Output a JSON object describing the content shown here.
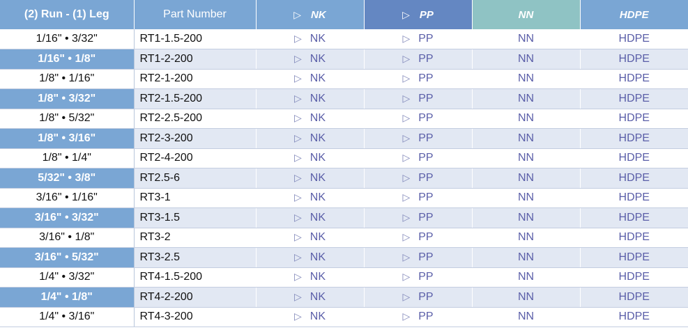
{
  "header": {
    "run_leg": "(2) Run - (1) Leg",
    "part_number": "Part Number",
    "materials": [
      {
        "label": "NK",
        "marker": "▷"
      },
      {
        "label": "PP",
        "marker": "▷"
      },
      {
        "label": "NN",
        "marker": ""
      },
      {
        "label": "HDPE",
        "marker": ""
      }
    ]
  },
  "colors": {
    "header_blue": "#7aa6d4",
    "header_pp": "#6487c2",
    "header_nn": "#8fc3c4",
    "row_alt": "#e2e8f3",
    "material_text": "#5a5ea8"
  },
  "rows": [
    {
      "size": "1/16\" • 3/32\"",
      "part": "RT1-1.5-200",
      "nk": "NK",
      "pp": "PP",
      "nn": "NN",
      "hdpe": "HDPE"
    },
    {
      "size": "1/16\" • 1/8\"",
      "part": "RT1-2-200",
      "nk": "NK",
      "pp": "PP",
      "nn": "NN",
      "hdpe": "HDPE"
    },
    {
      "size": "1/8\" • 1/16\"",
      "part": "RT2-1-200",
      "nk": "NK",
      "pp": "PP",
      "nn": "NN",
      "hdpe": "HDPE"
    },
    {
      "size": "1/8\" • 3/32\"",
      "part": "RT2-1.5-200",
      "nk": "NK",
      "pp": "PP",
      "nn": "NN",
      "hdpe": "HDPE"
    },
    {
      "size": "1/8\" • 5/32\"",
      "part": "RT2-2.5-200",
      "nk": "NK",
      "pp": "PP",
      "nn": "NN",
      "hdpe": "HDPE"
    },
    {
      "size": "1/8\" • 3/16\"",
      "part": "RT2-3-200",
      "nk": "NK",
      "pp": "PP",
      "nn": "NN",
      "hdpe": "HDPE"
    },
    {
      "size": "1/8\" • 1/4\"",
      "part": "RT2-4-200",
      "nk": "NK",
      "pp": "PP",
      "nn": "NN",
      "hdpe": "HDPE"
    },
    {
      "size": "5/32\" • 3/8\"",
      "part": "RT2.5-6",
      "nk": "NK",
      "pp": "PP",
      "nn": "NN",
      "hdpe": "HDPE"
    },
    {
      "size": "3/16\" • 1/16\"",
      "part": "RT3-1",
      "nk": "NK",
      "pp": "PP",
      "nn": "NN",
      "hdpe": "HDPE"
    },
    {
      "size": "3/16\" • 3/32\"",
      "part": "RT3-1.5",
      "nk": "NK",
      "pp": "PP",
      "nn": "NN",
      "hdpe": "HDPE"
    },
    {
      "size": "3/16\" • 1/8\"",
      "part": "RT3-2",
      "nk": "NK",
      "pp": "PP",
      "nn": "NN",
      "hdpe": "HDPE"
    },
    {
      "size": "3/16\" • 5/32\"",
      "part": "RT3-2.5",
      "nk": "NK",
      "pp": "PP",
      "nn": "NN",
      "hdpe": "HDPE"
    },
    {
      "size": "1/4\" • 3/32\"",
      "part": "RT4-1.5-200",
      "nk": "NK",
      "pp": "PP",
      "nn": "NN",
      "hdpe": "HDPE"
    },
    {
      "size": "1/4\" • 1/8\"",
      "part": "RT4-2-200",
      "nk": "NK",
      "pp": "PP",
      "nn": "NN",
      "hdpe": "HDPE"
    },
    {
      "size": "1/4\" • 3/16\"",
      "part": "RT4-3-200",
      "nk": "NK",
      "pp": "PP",
      "nn": "NN",
      "hdpe": "HDPE"
    }
  ],
  "row_marker": "▷"
}
